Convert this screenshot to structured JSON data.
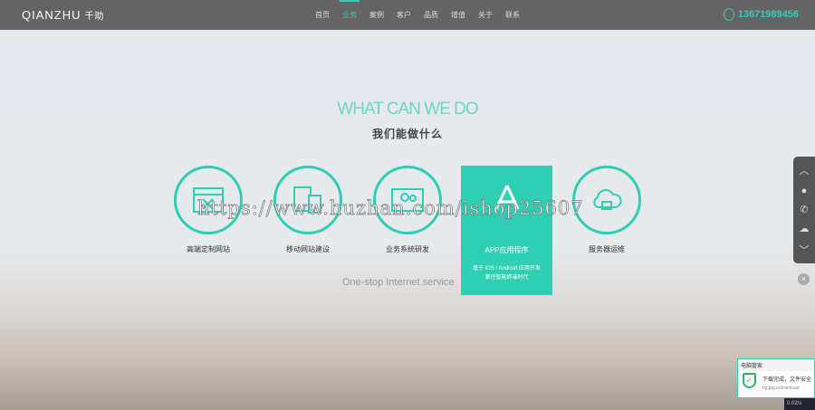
{
  "nav": {
    "logo": "QIANZHU",
    "logo_cn": "千助",
    "items": [
      "首页",
      "业务",
      "案例",
      "客户",
      "品质",
      "增值",
      "关于",
      "联系"
    ],
    "active": 1,
    "phone": "13671989456"
  },
  "hero": {
    "title": "WHAT CAN WE DO",
    "subtitle": "我们能做什么",
    "tagline": "One-stop Internet service"
  },
  "services": [
    {
      "label": "高端定制网站",
      "icon": "browser-tools-icon"
    },
    {
      "label": "移动网站建设",
      "icon": "devices-icon"
    },
    {
      "label": "业务系统研发",
      "icon": "gears-icon"
    },
    {
      "label": "APP应用程序",
      "icon": "app-store-icon",
      "desc1": "基于 iOS / Android 应用开发",
      "desc2": "掌控智能终端时代"
    },
    {
      "label": "服务器运维",
      "icon": "cloud-icon"
    }
  ],
  "watermark": "https://www.huzhan.com/ishop25607",
  "popup": {
    "title": "电脑管家",
    "message": "下载完成，文件安全",
    "file": "bg.jpg.crdownload"
  },
  "taskbar": "0.02/s"
}
